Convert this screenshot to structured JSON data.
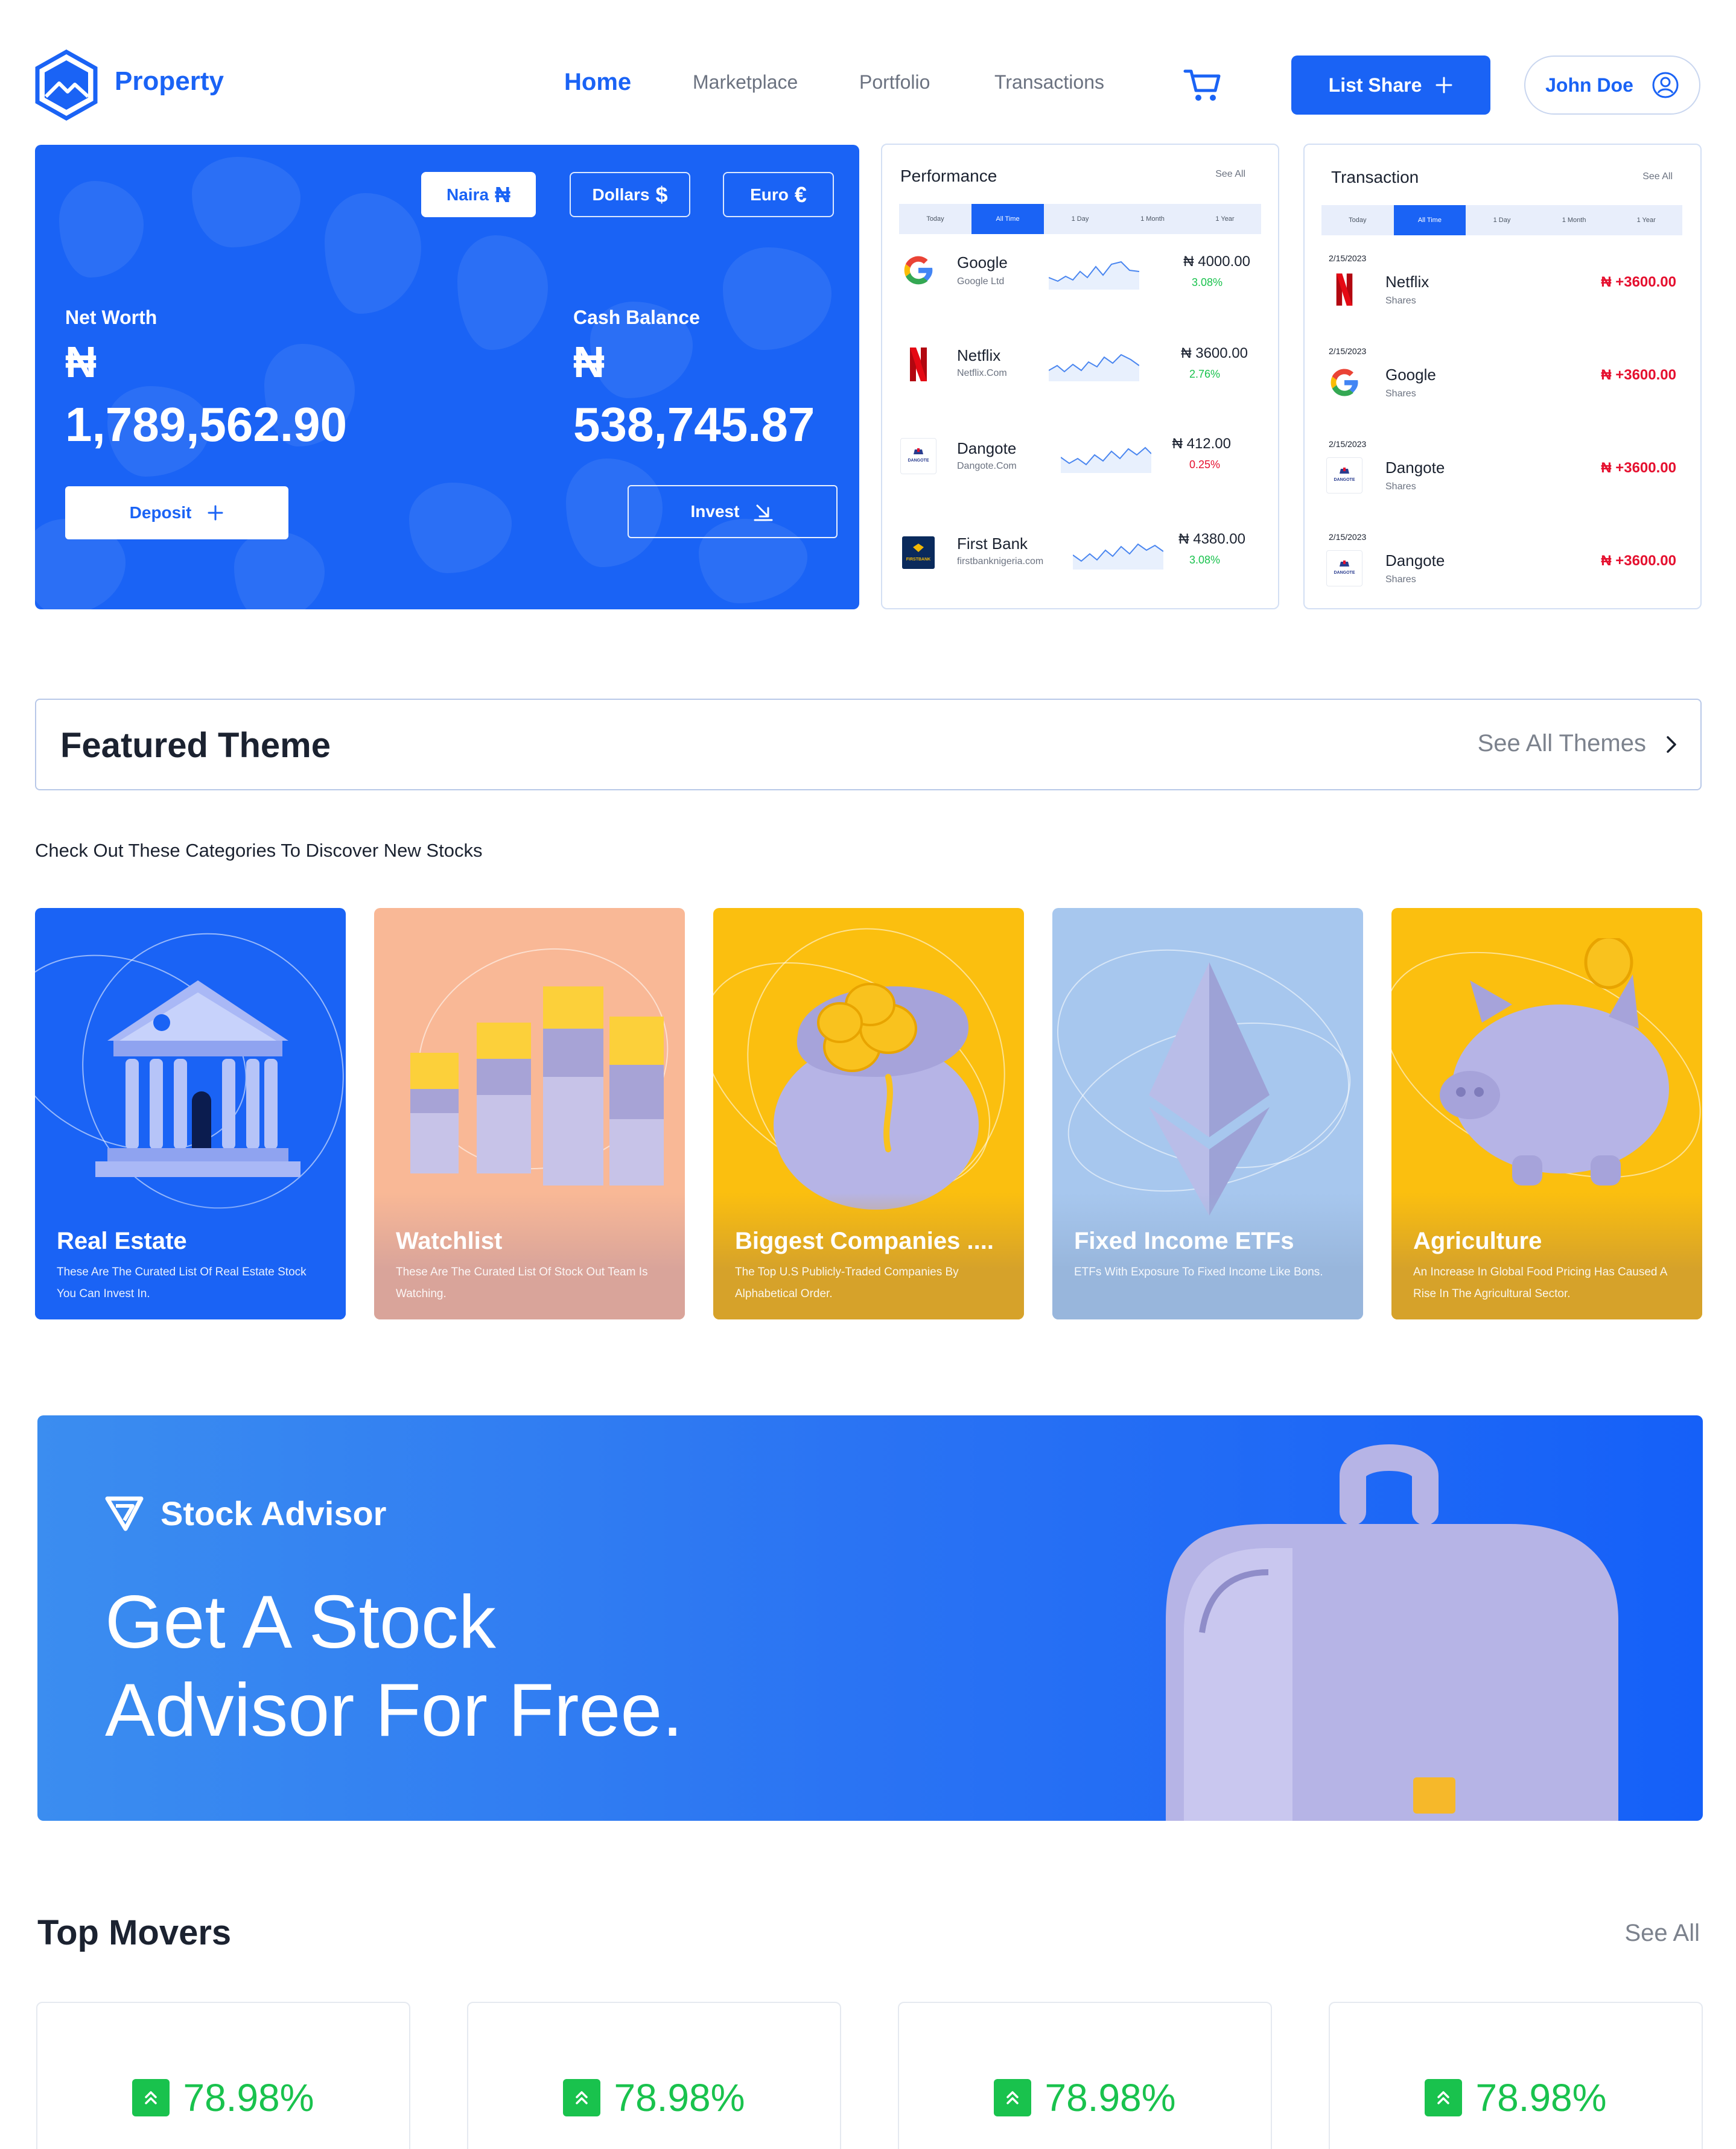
{
  "brand": {
    "name": "Property"
  },
  "nav": {
    "items": [
      "Home",
      "Marketplace",
      "Portfolio",
      "Transactions"
    ]
  },
  "header": {
    "list_share": "List Share",
    "user_name": "John Doe"
  },
  "hero": {
    "currencies": [
      {
        "label": "Naira",
        "symbol": "₦"
      },
      {
        "label": "Dollars",
        "symbol": "$"
      },
      {
        "label": "Euro",
        "symbol": "€"
      }
    ],
    "net_worth_label": "Net Worth",
    "net_worth_symbol": "₦",
    "net_worth_value": "1,789,562.90",
    "cash_label": "Cash Balance",
    "cash_symbol": "₦",
    "cash_value": "538,745.87",
    "deposit": "Deposit",
    "invest": "Invest"
  },
  "performance": {
    "title": "Performance",
    "see_all": "See All",
    "ranges": [
      "Today",
      "All Time",
      "1 Day",
      "1 Month",
      "1 Year"
    ],
    "selected_range": "All Time",
    "rows": [
      {
        "name": "Google",
        "sub": "Google Ltd",
        "amount": "₦ 4000.00",
        "pct": "3.08%",
        "trend": "up"
      },
      {
        "name": "Netflix",
        "sub": "Netflix.Com",
        "amount": "₦ 3600.00",
        "pct": "2.76%",
        "trend": "up"
      },
      {
        "name": "Dangote",
        "sub": "Dangote.Com",
        "amount": "₦ 412.00",
        "pct": "0.25%",
        "trend": "down"
      },
      {
        "name": "First Bank",
        "sub": "firstbanknigeria.com",
        "amount": "₦ 4380.00",
        "pct": "3.08%",
        "trend": "up"
      }
    ]
  },
  "transaction": {
    "title": "Transaction",
    "see_all": "See All",
    "ranges": [
      "Today",
      "All Time",
      "1 Day",
      "1 Month",
      "1 Year"
    ],
    "rows": [
      {
        "date": "2/15/2023",
        "name": "Netflix",
        "sub": "Shares",
        "amount": "₦ +3600.00"
      },
      {
        "date": "2/15/2023",
        "name": "Google",
        "sub": "Shares",
        "amount": "₦ +3600.00"
      },
      {
        "date": "2/15/2023",
        "name": "Dangote",
        "sub": "Shares",
        "amount": "₦ +3600.00"
      },
      {
        "date": "2/15/2023",
        "name": "Dangote",
        "sub": "Shares",
        "amount": "₦ +3600.00"
      }
    ]
  },
  "featured": {
    "title": "Featured Theme",
    "see_all": "See All Themes",
    "subtitle": "Check Out These Categories To Discover New Stocks",
    "categories": [
      {
        "title": "Real Estate",
        "desc": "These Are The Curated List Of Real Estate Stock You Can Invest In.",
        "color": "#1a63f5"
      },
      {
        "title": "Watchlist",
        "desc": "These Are The Curated List Of Stock Out Team Is Watching.",
        "color": "#f9b896"
      },
      {
        "title": "Biggest Companies ....",
        "desc": "The Top U.S Publicly-Traded Companies By Alphabetical Order.",
        "color": "#fbbf0f"
      },
      {
        "title": "Fixed Income ETFs",
        "desc": "ETFs With Exposure To Fixed Income Like Bons.",
        "color": "#a7c7ee"
      },
      {
        "title": "Agriculture",
        "desc": "An Increase In Global Food Pricing Has Caused A Rise In The Agricultural Sector.",
        "color": "#fbbf0f"
      }
    ]
  },
  "advisor": {
    "brand": "Stock Advisor",
    "headline_1": "Get A Stock",
    "headline_2": "Advisor For Free."
  },
  "movers": {
    "title": "Top Movers",
    "see_all": "See All",
    "items": [
      "78.98%",
      "78.98%",
      "78.98%",
      "78.98%"
    ]
  },
  "colors": {
    "accent": "#1a63f5",
    "positive": "#19c24d",
    "negative": "#e5102f"
  }
}
